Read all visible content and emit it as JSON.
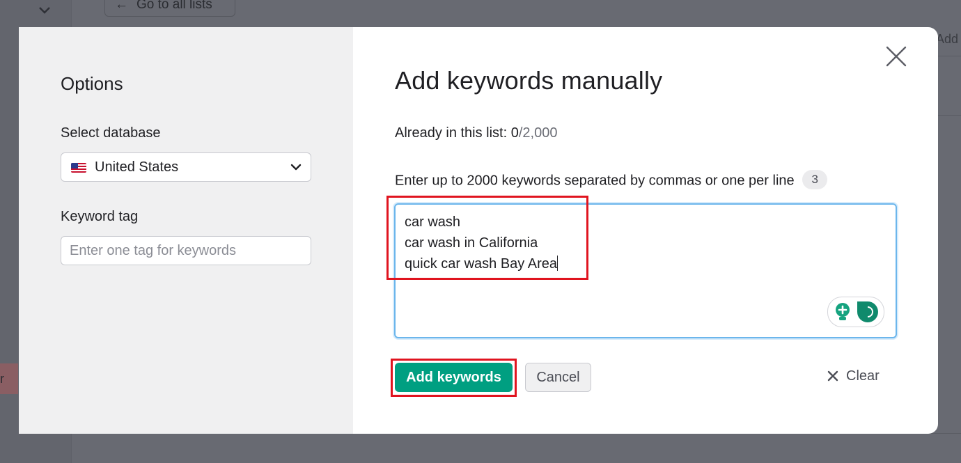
{
  "background": {
    "back_button_label": "Go to all lists",
    "right_add_label": "Add",
    "left_tag_label": "r"
  },
  "options": {
    "title": "Options",
    "database_label": "Select database",
    "database_value": "United States",
    "database_flag_icon": "us-flag-icon",
    "tag_label": "Keyword tag",
    "tag_placeholder": "Enter one tag for keywords"
  },
  "main": {
    "title": "Add keywords manually",
    "count_label": "Already in this list:",
    "count_current": "0",
    "count_max": "/2,000",
    "hint": "Enter up to 2000 keywords separated by commas or one per line",
    "keyword_count": "3",
    "keywords": [
      "car wash",
      "car wash in California",
      "quick car wash Bay Area"
    ],
    "add_button": "Add keywords",
    "cancel_button": "Cancel",
    "clear_button": "Clear"
  },
  "colors": {
    "primary": "#009f81",
    "highlight": "#e0141f",
    "focus": "#6cb6ec"
  }
}
